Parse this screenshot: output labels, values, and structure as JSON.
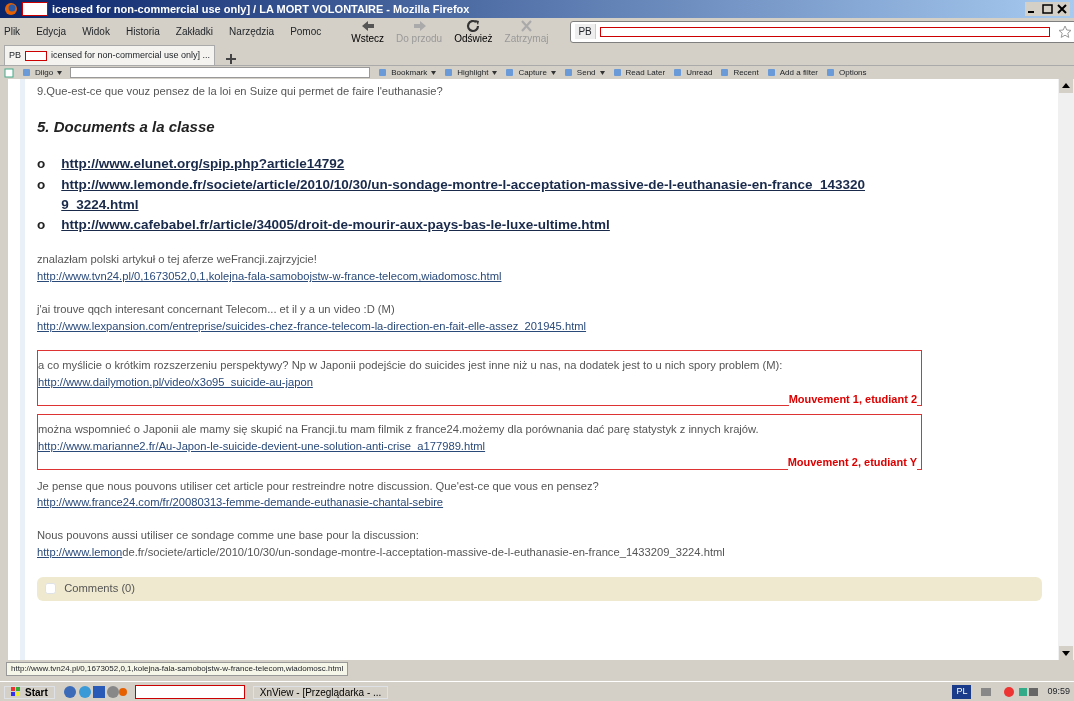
{
  "window": {
    "title": "icensed for non-commercial use only] / LA MORT VOLONTAIRE - Mozilla Firefox"
  },
  "menu": [
    "Plik",
    "Edycja",
    "Widok",
    "Historia",
    "Zakładki",
    "Narzędzia",
    "Pomoc"
  ],
  "nav_buttons": [
    {
      "kind": "back",
      "label": "Wstecz",
      "disabled": false
    },
    {
      "kind": "forward",
      "label": "Do przodu",
      "disabled": true
    },
    {
      "kind": "reload",
      "label": "Odśwież",
      "disabled": false
    },
    {
      "kind": "stop",
      "label": "Zatrzymaj",
      "disabled": true
    }
  ],
  "address": {
    "badge": "PB"
  },
  "tabs": [
    {
      "badge": "PB",
      "label": "icensed for non-commercial use only] ...",
      "selected": true
    }
  ],
  "toolbar": [
    {
      "label": "Diigo",
      "dropdown": true
    },
    {
      "label": "Bookmark",
      "dropdown": true
    },
    {
      "label": "Highlight",
      "dropdown": true
    },
    {
      "label": "Capture",
      "dropdown": true
    },
    {
      "label": "Send",
      "dropdown": true
    },
    {
      "label": "Read Later",
      "dropdown": false
    },
    {
      "label": "Unread",
      "dropdown": false
    },
    {
      "label": "Recent",
      "dropdown": false
    },
    {
      "label": "Add a filter",
      "dropdown": false
    },
    {
      "label": "Options",
      "dropdown": false
    }
  ],
  "content": {
    "question": "9.Que-est-ce que vouz pensez de la loi en Suize qui permet de faire l'euthanasie?",
    "heading": "5. Documents a la classe",
    "documents": [
      {
        "bullet": "o",
        "url": "http://www.elunet.org/spip.php?article14792"
      },
      {
        "bullet": "o",
        "url": "http://www.lemonde.fr/societe/article/2010/10/30/un-sondage-montre-l-acceptation-massive-de-l-euthanasie-en-france_1433209_3224.html"
      },
      {
        "bullet": "o",
        "url": "http://www.cafebabel.fr/article/34005/droit-de-mourir-aux-pays-bas-le-luxe-ultime.html"
      }
    ],
    "posts": [
      {
        "text": "znalazłam polski artykuł o tej aferze weFrancji.zajrzyjcie!",
        "link": "http://www.tvn24.pl/0,1673052,0,1,kolejna-fala-samobojstw-w-france-telecom,wiadomosc.html"
      },
      {
        "text": "j'ai trouve qqch interesant concernant Telecom... et il y a un video :D (M)",
        "link": "http://www.lexpansion.com/entreprise/suicides-chez-france-telecom-la-direction-en-fait-elle-assez_201945.html"
      },
      {
        "text": "a co myślicie o krótkim rozszerzeniu perspektywy? Np w Japonii podejście do suicides jest inne niż u nas, na dodatek jest to u nich spory problem (M):",
        "link": "http://www.dailymotion.pl/video/x3o95_suicide-au-japon",
        "annotation": "Mouvement 1, etudiant 2"
      },
      {
        "text": "można wspomnieć o Japonii ale mamy się skupić na Francji.tu mam filmik z france24.możemy dla porównania dać parę statystyk z innych krajów.",
        "link": "http://www.marianne2.fr/Au-Japon-le-suicide-devient-une-solution-anti-crise_a177989.html",
        "annotation": "Mouvement 2, etudiant Y"
      },
      {
        "text": "Je pense que nous pouvons utiliser cet article pour restreindre notre discussion. Que'est-ce que vous en pensez?",
        "link": "http://www.france24.com/fr/20080313-femme-demande-euthanasie-chantal-sebire"
      },
      {
        "text": "Nous pouvons aussi utiliser ce sondage comme une base pour la discussion:",
        "link": "http://www.lemon",
        "tail": "de.fr/societe/article/2010/10/30/un-sondage-montre-l-acceptation-massive-de-l-euthanasie-en-france_1433209_3224.html"
      }
    ],
    "comments": {
      "label": "Comments (0)",
      "checked": false
    }
  },
  "status_bar": "http://www.tvn24.pl/0,1673052,0,1,kolejna-fala-samobojstw-w-france-telecom,wiadomosc.html",
  "taskbar": {
    "start": "Start",
    "windows": [
      "XnView - [Przeglądarka - ..."
    ],
    "language": "PL",
    "clock": "09:59"
  }
}
